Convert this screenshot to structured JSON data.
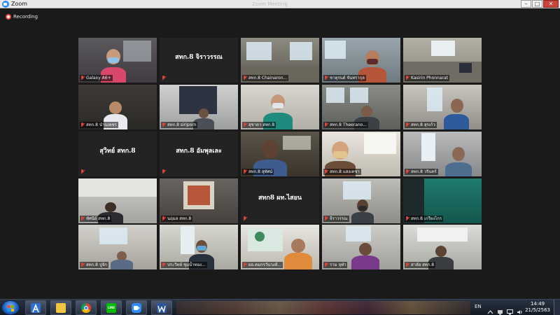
{
  "window": {
    "title": "Zoom",
    "meeting_title": "Zoom Meeting",
    "controls": {
      "minimize": "–",
      "maximize": "□",
      "close": "✕"
    }
  },
  "recording": {
    "label": "Recording",
    "color": "#e84b3c"
  },
  "colors": {
    "active_speaker_border": "#e3d65a",
    "muted_mic": "#e0453a",
    "tile_bg": "#232323"
  },
  "tiles": [
    {
      "name": "Galaxy A6+",
      "video": true,
      "muted": true
    },
    {
      "name": "สทก.8 จิราวรรณ",
      "video": false,
      "muted": true
    },
    {
      "name": "สทก.8 Chainaron...",
      "video": true,
      "muted": true
    },
    {
      "name": "ชาตุรนต์ จันทรากุล",
      "video": true,
      "muted": true
    },
    {
      "name": "Kasirin Phonnarat",
      "video": true,
      "muted": true
    },
    {
      "name": "สทก.8 นำนเพชร",
      "video": true,
      "muted": true
    },
    {
      "name": "สทก.8 siriporn",
      "video": true,
      "muted": true
    },
    {
      "name": "สุชาดา สทก.8",
      "video": true,
      "muted": true
    },
    {
      "name": "สทก.8 Theerano...",
      "video": true,
      "muted": true
    },
    {
      "name": "สทก.8 สุรเก้ว",
      "video": true,
      "muted": true
    },
    {
      "name": "สุวิทย์ สทก.8",
      "video": false,
      "muted": true
    },
    {
      "name": "สทก.8 อัมพุลเละ",
      "video": false,
      "muted": true
    },
    {
      "name": "สทก.8 สุทัศน์",
      "video": true,
      "muted": true,
      "active": true
    },
    {
      "name": "สทก.8 แสงเดชา",
      "video": true,
      "muted": true
    },
    {
      "name": "สทก.8 วรินทร์",
      "video": true,
      "muted": true
    },
    {
      "name": "ทัศนีย์ สทก.8",
      "video": true,
      "muted": true
    },
    {
      "name": "นฤมล สทก.8",
      "video": true,
      "muted": true
    },
    {
      "name": "สทก8 ผท.ไสยน",
      "video": false,
      "muted": true
    },
    {
      "name": "จีราวรรณ",
      "video": true,
      "muted": true
    },
    {
      "name": "สทก.8 เกรียงไกร",
      "video": true,
      "muted": true
    },
    {
      "name": "สทก.8 ปูจัก",
      "video": true,
      "muted": true
    },
    {
      "name": "ประวิทย์ ชุมน้ำทอง...",
      "video": true,
      "muted": true
    },
    {
      "name": "ผอ.คมกรวันวงส์...",
      "video": true,
      "muted": true
    },
    {
      "name": "ราม จุฬา",
      "video": true,
      "muted": true
    },
    {
      "name": "สาลัย สทก.8",
      "video": true,
      "muted": true
    }
  ],
  "taskbar": {
    "apps": [
      {
        "name": "start"
      },
      {
        "name": "line-icon",
        "glyph": "LINE"
      },
      {
        "name": "zoom-icon"
      }
    ],
    "tray": {
      "language": "EN",
      "time": "14:49",
      "date": "21/5/2563"
    }
  }
}
